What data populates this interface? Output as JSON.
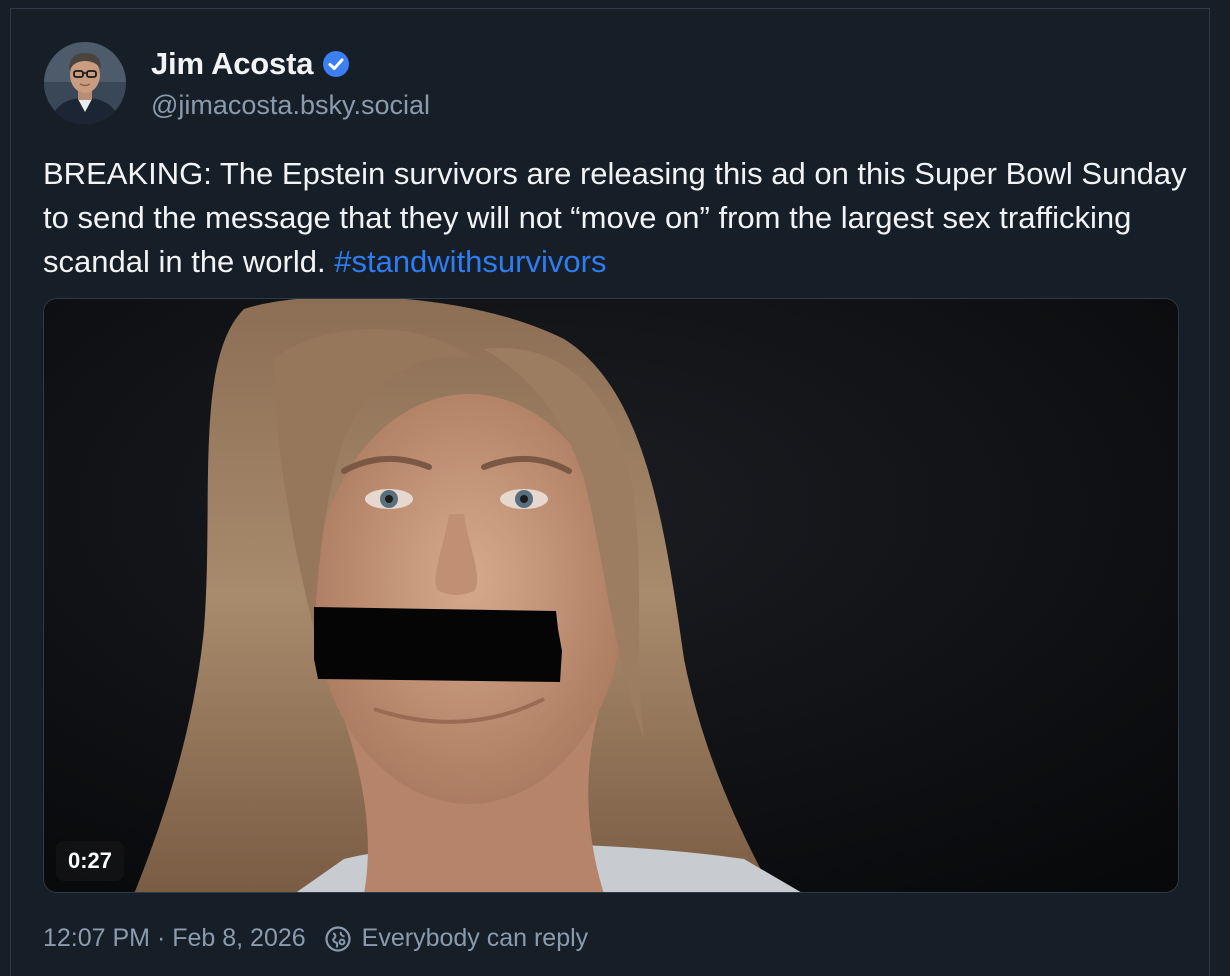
{
  "post": {
    "author": {
      "display_name": "Jim Acosta",
      "handle": "@jimacosta.bsky.social",
      "verified": true
    },
    "text_before_tag": "BREAKING: The Epstein survivors are releasing this ad on this Super Bowl Sunday to send the message that they will not “move on” from the largest sex trafficking scandal in the world. ",
    "hashtag": "#standwithsurvivors",
    "video": {
      "duration": "0:27"
    },
    "timestamp": "12:07 PM · Feb 8, 2026",
    "reply_setting": "Everybody can reply"
  },
  "colors": {
    "background": "#161e27",
    "text_primary": "#f1f3f5",
    "text_secondary": "#8a9bae",
    "link": "#2f7cf0",
    "verified": "#3b7ff2"
  },
  "icons": {
    "verified": "verified-check-icon",
    "reply_setting": "globe-icon"
  }
}
